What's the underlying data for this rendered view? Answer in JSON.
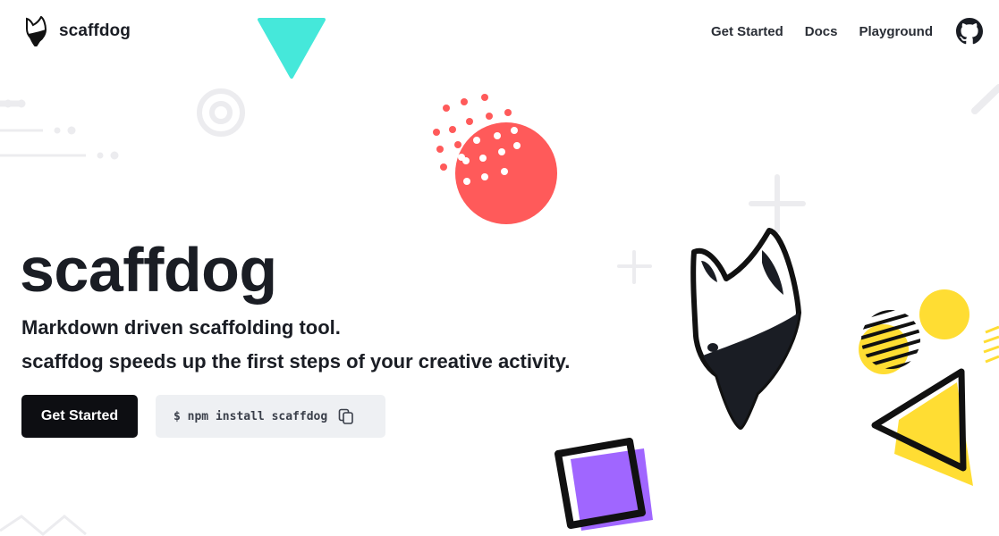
{
  "brand": {
    "name": "scaffdog"
  },
  "nav": {
    "items": [
      {
        "label": "Get Started"
      },
      {
        "label": "Docs"
      },
      {
        "label": "Playground"
      }
    ],
    "github_icon": "github-icon"
  },
  "hero": {
    "title": "scaffdog",
    "tagline_1": "Markdown driven scaffolding tool.",
    "tagline_2": "scaffdog speeds up the first steps of your creative activity.",
    "cta_label": "Get Started",
    "install_command": "$ npm install scaffdog",
    "copy_icon": "copy-icon"
  },
  "colors": {
    "teal": "#45E8DA",
    "coral": "#FF5A5A",
    "yellow": "#FFDD33",
    "purple": "#A066FF",
    "dark": "#1A1D24"
  }
}
